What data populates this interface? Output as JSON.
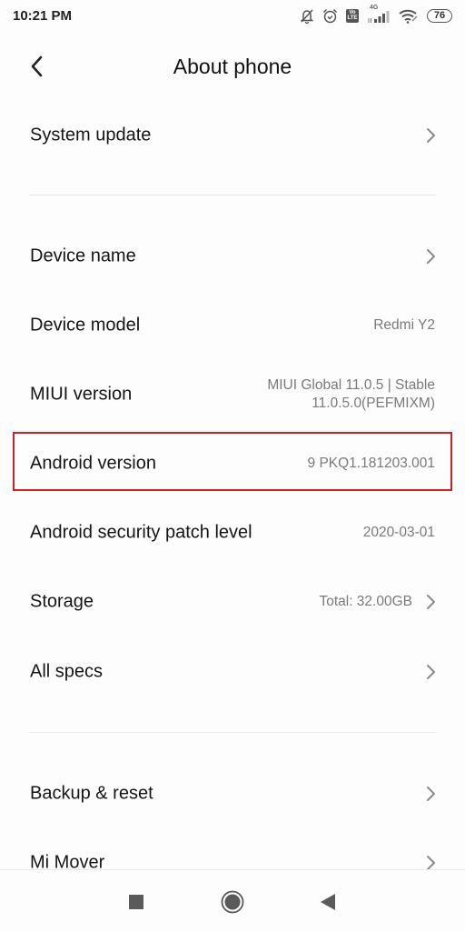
{
  "status_bar": {
    "time": "10:21 PM",
    "icons": [
      "bell-off-icon",
      "alarm-icon",
      "volte-icon",
      "signal-4g-icon",
      "wifi-icon"
    ],
    "volte_top": "Vo",
    "volte_bottom": "LTE",
    "network_label": "4G",
    "battery_level": "76"
  },
  "header": {
    "back_icon": "chevron-left-icon",
    "title": "About phone"
  },
  "sections": [
    {
      "items": [
        {
          "label": "System update",
          "value": "",
          "chevron": true
        }
      ]
    },
    {
      "items": [
        {
          "label": "Device name",
          "value": "",
          "chevron": true
        },
        {
          "label": "Device model",
          "value": "Redmi Y2",
          "chevron": false
        },
        {
          "label": "MIUI version",
          "value_line1": "MIUI Global 11.0.5 | Stable",
          "value_line2": "11.0.5.0(PEFMIXM)",
          "chevron": false
        },
        {
          "label": "Android version",
          "value": "9 PKQ1.181203.001",
          "chevron": false,
          "highlighted": true
        },
        {
          "label": "Android security patch level",
          "value": "2020-03-01",
          "chevron": false
        },
        {
          "label": "Storage",
          "value": "Total: 32.00GB",
          "chevron": true
        },
        {
          "label": "All specs",
          "value": "",
          "chevron": true
        }
      ]
    },
    {
      "items": [
        {
          "label": "Backup & reset",
          "value": "",
          "chevron": true
        },
        {
          "label": "Mi Mover",
          "value": "",
          "chevron": true
        }
      ]
    }
  ],
  "highlight_color": "#d0202a",
  "nav_bar": {
    "recents_icon": "square-icon",
    "home_icon": "circle-home-icon",
    "back_icon": "triangle-back-icon"
  }
}
